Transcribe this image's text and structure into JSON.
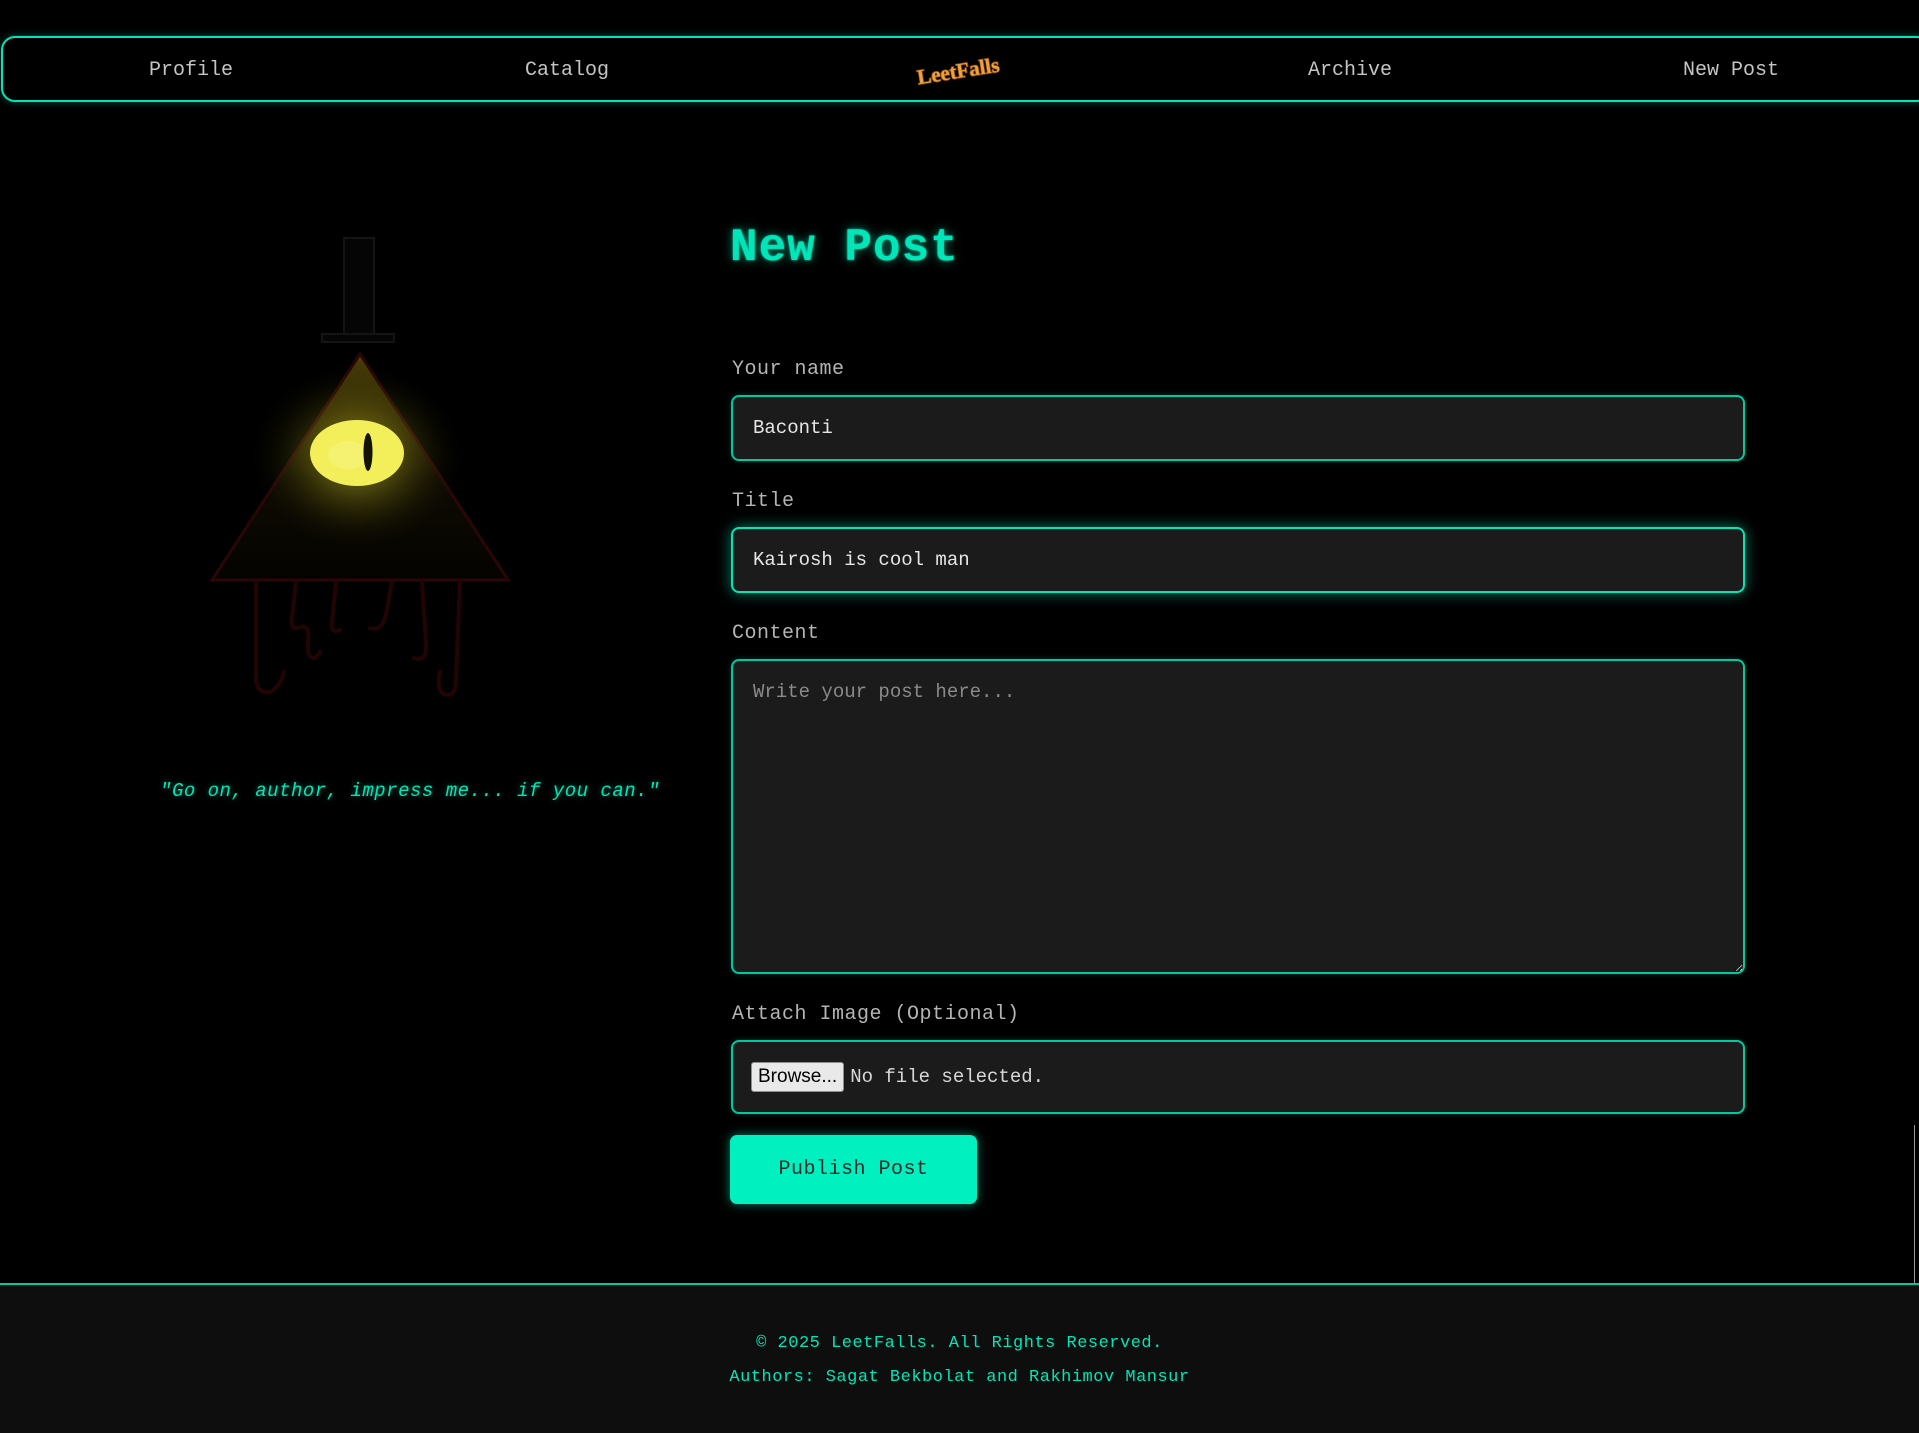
{
  "colors": {
    "accent": "#00e6b8",
    "background": "#000000",
    "field_background": "#1b1b1b",
    "footer_background": "#0e0e0e",
    "eye_glow": "#f4f04a"
  },
  "nav": {
    "profile": "Profile",
    "catalog": "Catalog",
    "logo_text": "LeetFalls",
    "archive": "Archive",
    "new_post": "New Post"
  },
  "sidebar": {
    "mascot_icon": "glowing-triangle-eye-icon",
    "quote": "\"Go on, author, impress me... if you can.\""
  },
  "form": {
    "title": "New Post",
    "name_label": "Your name",
    "name_value": "Baconti",
    "title_label": "Title",
    "title_value": "Kairosh is cool man",
    "content_label": "Content",
    "content_value": "",
    "content_placeholder": "Write your post here...",
    "image_label": "Attach Image (Optional)",
    "browse_label": "Browse...",
    "file_status": "No file selected.",
    "publish_label": "Publish Post"
  },
  "footer": {
    "copyright": "© 2025 LeetFalls. All Rights Reserved.",
    "authors": "Authors: Sagat Bekbolat and Rakhimov Mansur"
  }
}
